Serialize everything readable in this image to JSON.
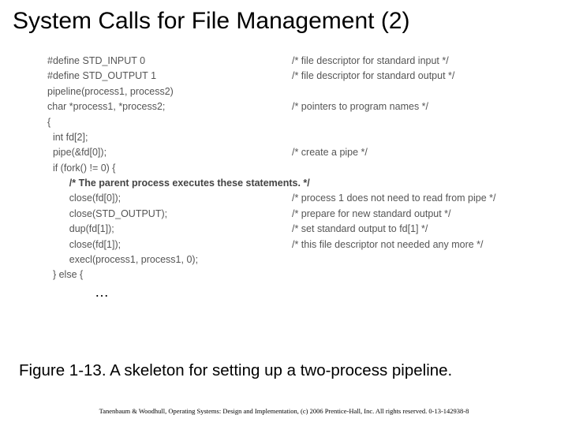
{
  "title": "System Calls for File Management (2)",
  "code": {
    "l0": {
      "c": "#define STD_INPUT 0",
      "m": "/* file descriptor for standard input */"
    },
    "l1": {
      "c": "#define STD_OUTPUT 1",
      "m": "/* file descriptor for standard output */"
    },
    "l2": {
      "c": "",
      "m": ""
    },
    "l3": {
      "c": "pipeline(process1, process2)",
      "m": ""
    },
    "l4": {
      "c": "char *process1, *process2;",
      "m": "/* pointers to program names */"
    },
    "l5": {
      "c": "{",
      "m": ""
    },
    "l6": {
      "c": "  int fd[2];",
      "m": ""
    },
    "l7": {
      "c": "",
      "m": ""
    },
    "l8": {
      "c": "  pipe(&fd[0]);",
      "m": "/* create a pipe */"
    },
    "l9": {
      "c": "  if (fork() != 0) {",
      "m": ""
    },
    "l10": {
      "c": "        /* The parent process executes these statements. */",
      "m": ""
    },
    "l11": {
      "c": "        close(fd[0]);",
      "m": "/* process 1 does not need to read from pipe */"
    },
    "l12": {
      "c": "        close(STD_OUTPUT);",
      "m": "/* prepare for new standard output */"
    },
    "l13": {
      "c": "        dup(fd[1]);",
      "m": "/* set standard output to fd[1] */"
    },
    "l14": {
      "c": "        close(fd[1]);",
      "m": "/* this file descriptor not needed any more */"
    },
    "l15": {
      "c": "        execl(process1, process1, 0);",
      "m": ""
    },
    "l16": {
      "c": "  } else {",
      "m": ""
    }
  },
  "ellipsis": "…",
  "caption": "Figure 1-13. A skeleton for setting up a two-process pipeline.",
  "footer": "Tanenbaum & Woodhull, Operating Systems: Design and Implementation, (c) 2006 Prentice-Hall, Inc. All rights reserved. 0-13-142938-8"
}
